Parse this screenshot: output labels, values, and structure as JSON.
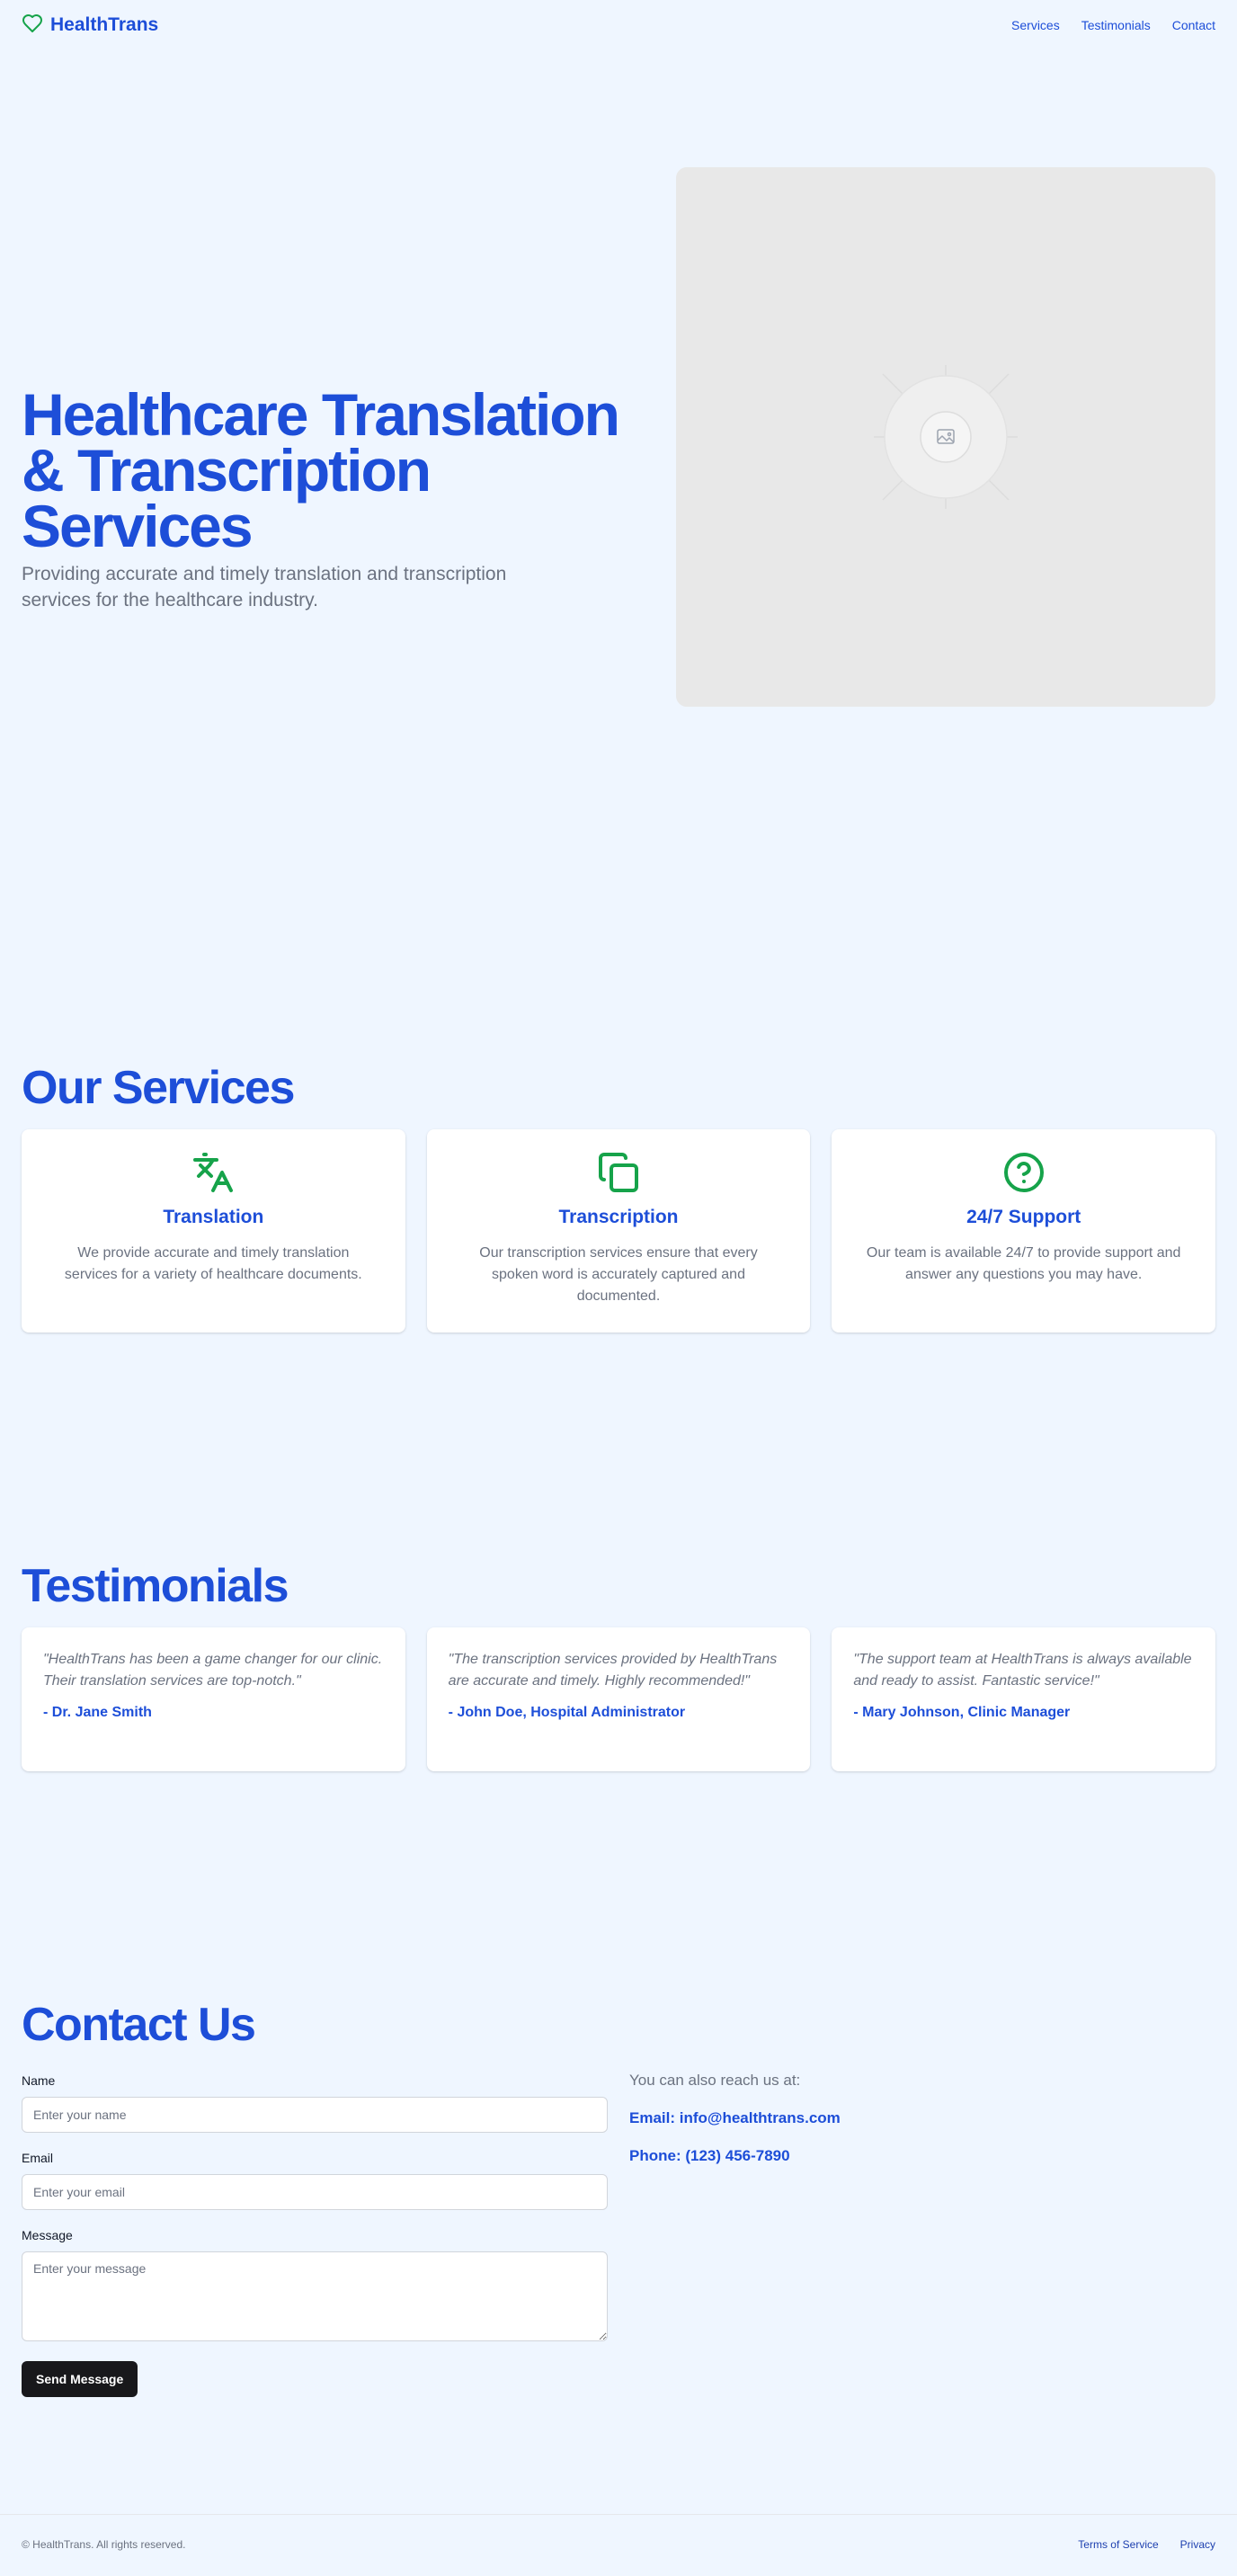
{
  "brand": {
    "name": "HealthTrans",
    "icon": "heart-icon",
    "accent": "#1d4ed8",
    "icon_color": "#16a34a"
  },
  "nav": [
    {
      "label": "Services"
    },
    {
      "label": "Testimonials"
    },
    {
      "label": "Contact"
    }
  ],
  "hero": {
    "title": "Healthcare Translation & Transcription Services",
    "subtitle": "Providing accurate and timely translation and transcription services for the healthcare industry.",
    "image_icon": "image-placeholder-icon"
  },
  "services": {
    "title": "Our Services",
    "items": [
      {
        "icon": "translate-icon",
        "title": "Translation",
        "description": "We provide accurate and timely translation services for a variety of healthcare documents."
      },
      {
        "icon": "copy-icon",
        "title": "Transcription",
        "description": "Our transcription services ensure that every spoken word is accurately captured and documented."
      },
      {
        "icon": "help-circle-icon",
        "title": "24/7 Support",
        "description": "Our team is available 24/7 to provide support and answer any questions you may have."
      }
    ]
  },
  "testimonials": {
    "title": "Testimonials",
    "items": [
      {
        "quote": "\"HealthTrans has been a game changer for our clinic. Their translation services are top-notch.\"",
        "author": "- Dr. Jane Smith"
      },
      {
        "quote": "\"The transcription services provided by HealthTrans are accurate and timely. Highly recommended!\"",
        "author": "- John Doe, Hospital Administrator"
      },
      {
        "quote": "\"The support team at HealthTrans is always available and ready to assist. Fantastic service!\"",
        "author": "- Mary Johnson, Clinic Manager"
      }
    ]
  },
  "contact": {
    "title": "Contact Us",
    "form": {
      "name_label": "Name",
      "name_placeholder": "Enter your name",
      "email_label": "Email",
      "email_placeholder": "Enter your email",
      "message_label": "Message",
      "message_placeholder": "Enter your message",
      "submit_label": "Send Message"
    },
    "info": {
      "lead": "You can also reach us at:",
      "email": "Email: info@healthtrans.com",
      "phone": "Phone: (123) 456-7890"
    }
  },
  "footer": {
    "copyright": "© HealthTrans. All rights reserved.",
    "links": [
      {
        "label": "Terms of Service"
      },
      {
        "label": "Privacy"
      }
    ]
  }
}
